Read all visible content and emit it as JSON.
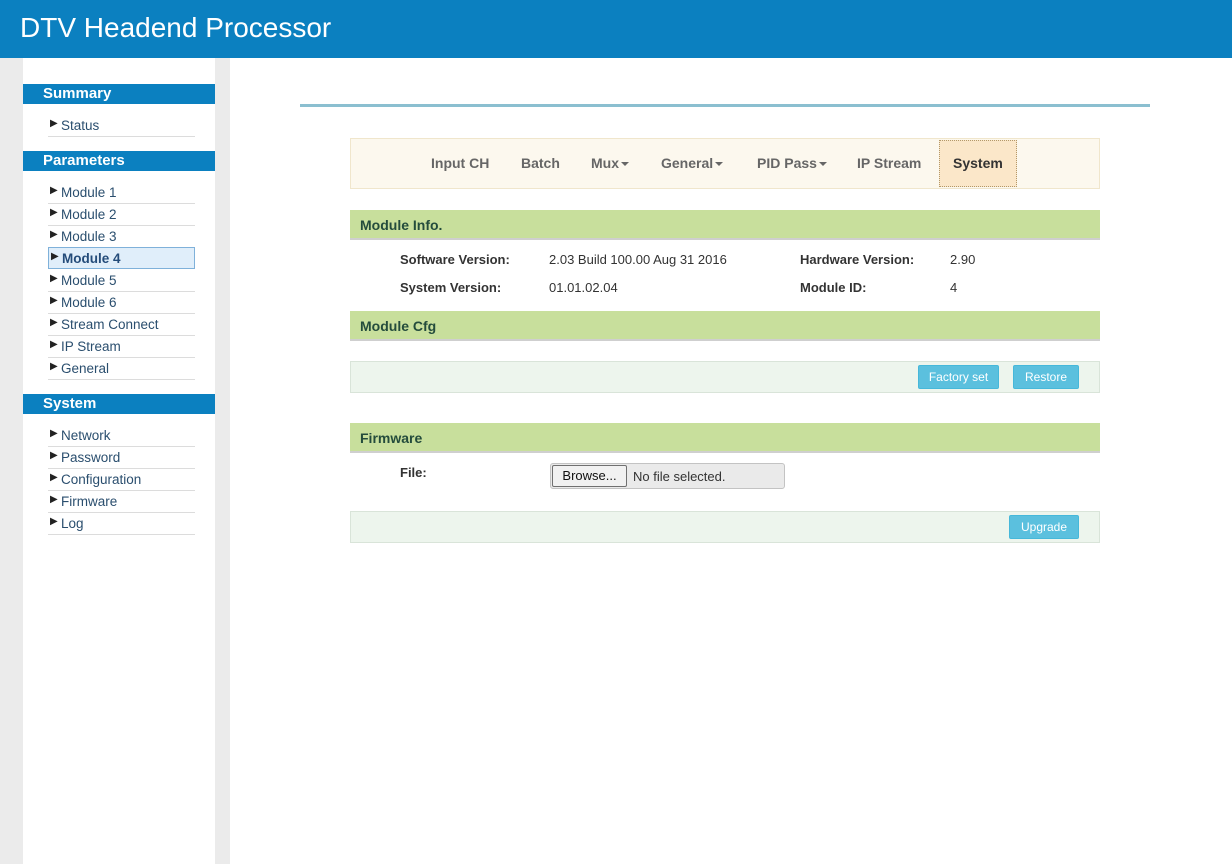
{
  "header": {
    "title": "DTV Headend Processor"
  },
  "sidebar": {
    "summary": {
      "heading": "Summary",
      "items": [
        "Status"
      ]
    },
    "parameters": {
      "heading": "Parameters",
      "items": [
        "Module 1",
        "Module 2",
        "Module 3",
        "Module 4",
        "Module 5",
        "Module 6",
        "Stream Connect",
        "IP Stream",
        "General"
      ]
    },
    "system": {
      "heading": "System",
      "items": [
        "Network",
        "Password",
        "Configuration",
        "Firmware",
        "Log"
      ]
    }
  },
  "nav": {
    "items": [
      "Input CH",
      "Batch",
      "Mux",
      "General",
      "PID Pass",
      "IP Stream",
      "System"
    ],
    "active": "System"
  },
  "module_info": {
    "title": "Module Info.",
    "software_version_label": "Software Version:",
    "software_version": "2.03 Build 100.00 Aug 31 2016",
    "hardware_version_label": "Hardware Version:",
    "hardware_version": "2.90",
    "system_version_label": "System Version:",
    "system_version": "01.01.02.04",
    "module_id_label": "Module ID:",
    "module_id": "4"
  },
  "module_cfg": {
    "title": "Module Cfg",
    "factory_set_label": "Factory set",
    "restore_label": "Restore"
  },
  "firmware": {
    "title": "Firmware",
    "file_label": "File:",
    "browse_label": "Browse...",
    "no_file_text": "No file selected.",
    "upgrade_label": "Upgrade"
  },
  "colors": {
    "brand": "#0b80c0",
    "section_header": "#c8df9c",
    "button": "#5bc0de"
  },
  "icons": {
    "sidebar_bullet": "triangle-right-icon",
    "dropdown": "caret-down-icon"
  }
}
